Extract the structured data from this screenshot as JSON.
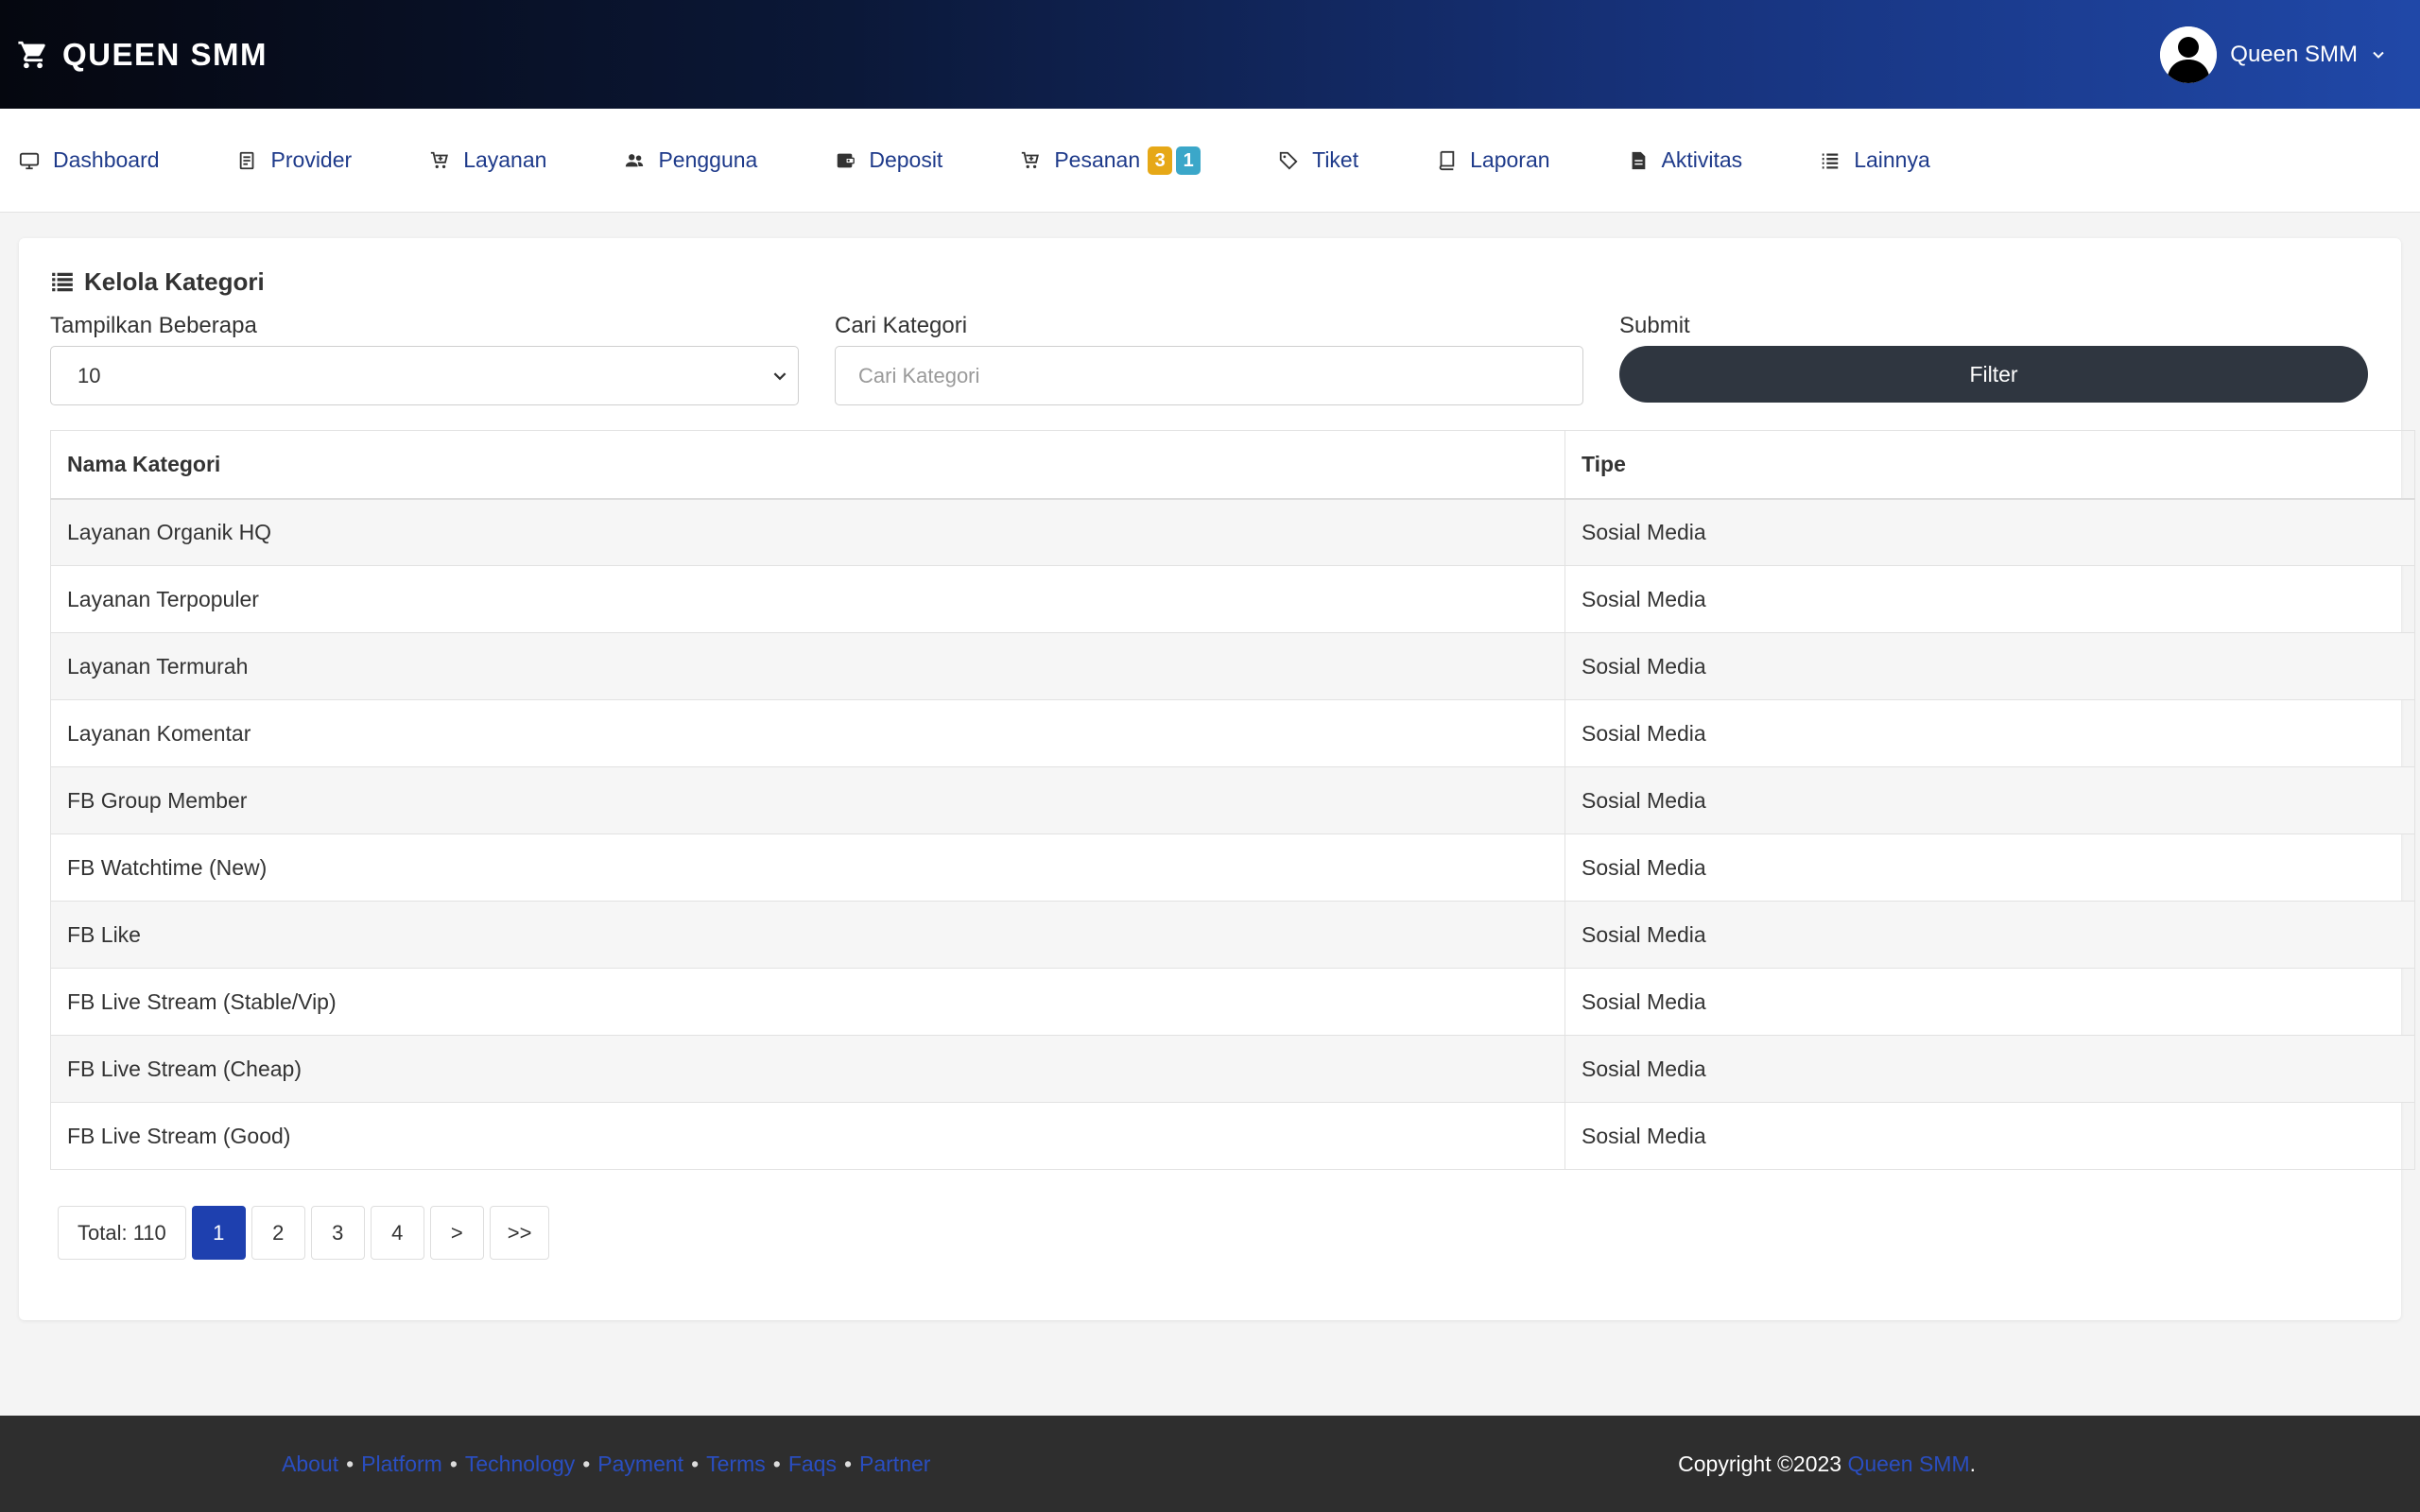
{
  "header": {
    "brand": "QUEEN SMM",
    "user_name": "Queen SMM"
  },
  "nav": {
    "items": [
      {
        "label": "Dashboard",
        "icon": "monitor-icon"
      },
      {
        "label": "Provider",
        "icon": "server-icon"
      },
      {
        "label": "Layanan",
        "icon": "cart-plus-icon"
      },
      {
        "label": "Pengguna",
        "icon": "users-icon"
      },
      {
        "label": "Deposit",
        "icon": "wallet-icon"
      },
      {
        "label": "Pesanan",
        "icon": "cart-icon",
        "badges": [
          "3",
          "1"
        ]
      },
      {
        "label": "Tiket",
        "icon": "tag-icon"
      },
      {
        "label": "Laporan",
        "icon": "book-icon"
      },
      {
        "label": "Aktivitas",
        "icon": "file-icon"
      },
      {
        "label": "Lainnya",
        "icon": "list-icon"
      }
    ]
  },
  "card": {
    "title": "Kelola Kategori",
    "filters": {
      "show_label": "Tampilkan Beberapa",
      "show_value": "10",
      "search_label": "Cari Kategori",
      "search_placeholder": "Cari Kategori",
      "submit_label": "Submit",
      "filter_button": "Filter"
    },
    "table": {
      "columns": [
        "Nama Kategori",
        "Tipe"
      ],
      "rows": [
        [
          "Layanan Organik HQ",
          "Sosial Media"
        ],
        [
          "Layanan Terpopuler",
          "Sosial Media"
        ],
        [
          "Layanan Termurah",
          "Sosial Media"
        ],
        [
          "Layanan Komentar",
          "Sosial Media"
        ],
        [
          "FB Group Member",
          "Sosial Media"
        ],
        [
          "FB Watchtime (New)",
          "Sosial Media"
        ],
        [
          "FB Like",
          "Sosial Media"
        ],
        [
          "FB Live Stream (Stable/Vip)",
          "Sosial Media"
        ],
        [
          "FB Live Stream (Cheap)",
          "Sosial Media"
        ],
        [
          "FB Live Stream (Good)",
          "Sosial Media"
        ]
      ]
    },
    "pagination": {
      "total": "Total: 110",
      "pages": [
        "1",
        "2",
        "3",
        "4"
      ],
      "active": "1",
      "next": ">",
      "last": ">>"
    }
  },
  "footer": {
    "links": [
      "About",
      "Platform",
      "Technology",
      "Payment",
      "Terms",
      "Faqs",
      "Partner"
    ],
    "copyright": "Copyright ©2023",
    "site_name": "Queen SMM",
    "period": "."
  }
}
